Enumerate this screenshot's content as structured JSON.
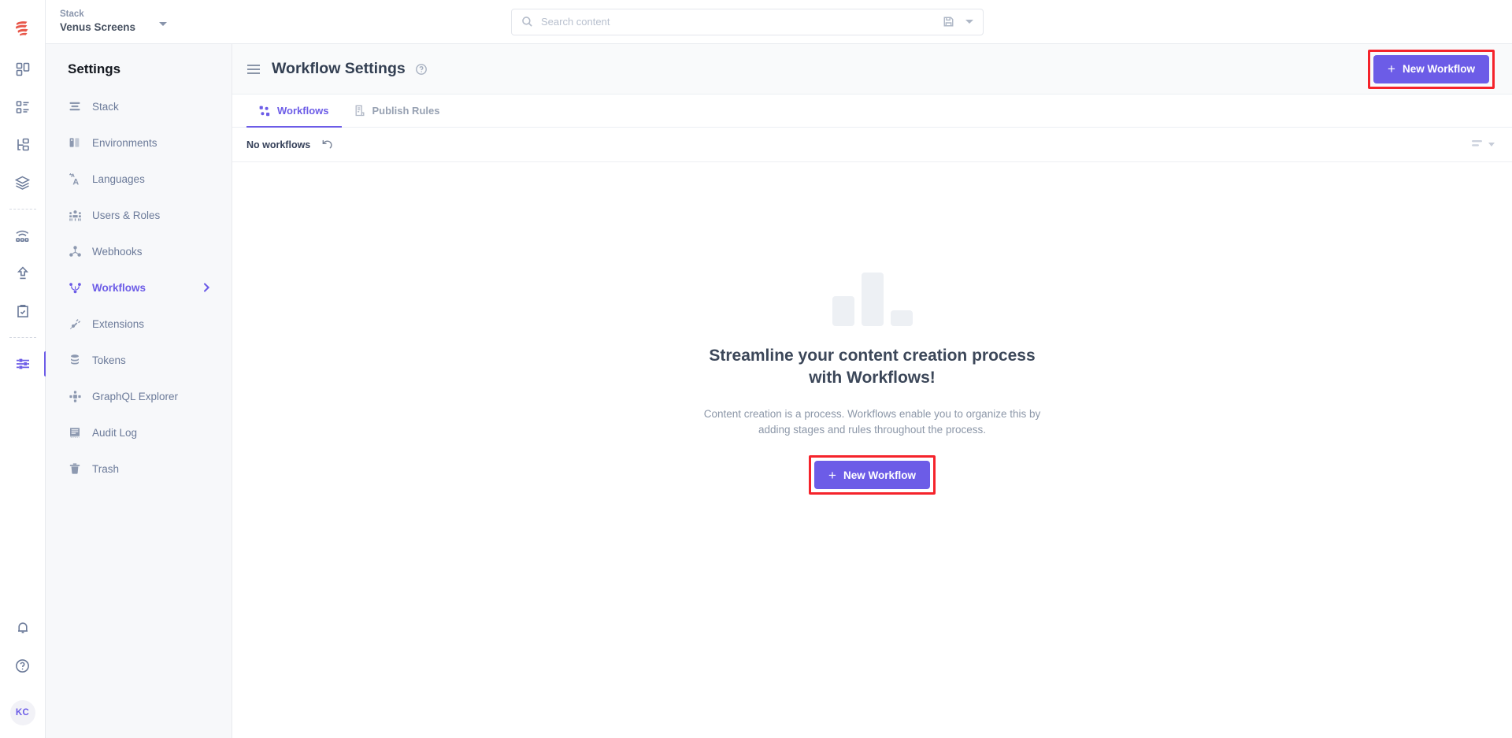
{
  "brand": {
    "accent": "#6c5ce7",
    "annotation": "#f5232b",
    "logo_icon": "contentstack-logo-icon"
  },
  "topbar": {
    "stack_label": "Stack",
    "stack_name": "Venus Screens",
    "stack_caret_icon": "chevron-down-icon",
    "search": {
      "placeholder": "Search content",
      "value": "",
      "search_icon": "search-icon",
      "save_icon": "save-icon",
      "caret_icon": "chevron-down-icon"
    }
  },
  "rail": {
    "items": [
      {
        "name": "dashboard",
        "icon": "dashboard-grid-icon",
        "active": false
      },
      {
        "name": "entries",
        "icon": "list-icon",
        "active": false
      },
      {
        "name": "content-models",
        "icon": "sitemap-icon",
        "active": false
      },
      {
        "name": "assets",
        "icon": "layers-icon",
        "active": false
      },
      {
        "name": "live-preview",
        "icon": "broadcast-icon",
        "active": false
      },
      {
        "name": "releases",
        "icon": "upload-arrow-icon",
        "active": false
      },
      {
        "name": "publish-queue",
        "icon": "clipboard-check-icon",
        "active": false
      },
      {
        "name": "settings",
        "icon": "sliders-icon",
        "active": true
      }
    ],
    "bottom": [
      {
        "name": "notifications",
        "icon": "bell-icon"
      },
      {
        "name": "help",
        "icon": "question-circle-icon"
      }
    ],
    "avatar_initials": "KC"
  },
  "settings_sidebar": {
    "title": "Settings",
    "items": [
      {
        "label": "Stack",
        "icon": "stack-icon",
        "active": false
      },
      {
        "label": "Environments",
        "icon": "environments-icon",
        "active": false
      },
      {
        "label": "Languages",
        "icon": "translate-icon",
        "active": false
      },
      {
        "label": "Users & Roles",
        "icon": "users-icon",
        "active": false
      },
      {
        "label": "Webhooks",
        "icon": "webhooks-icon",
        "active": false
      },
      {
        "label": "Workflows",
        "icon": "workflows-icon",
        "active": true,
        "chevron_icon": "chevron-right-icon"
      },
      {
        "label": "Extensions",
        "icon": "extensions-plug-icon",
        "active": false
      },
      {
        "label": "Tokens",
        "icon": "tokens-database-icon",
        "active": false
      },
      {
        "label": "GraphQL Explorer",
        "icon": "graphql-icon",
        "active": false
      },
      {
        "label": "Audit Log",
        "icon": "audit-log-icon",
        "active": false
      },
      {
        "label": "Trash",
        "icon": "trash-icon",
        "active": false
      }
    ]
  },
  "page": {
    "menu_icon": "hamburger-icon",
    "title": "Workflow Settings",
    "help_icon": "question-circle-icon",
    "new_workflow_label": "New Workflow",
    "new_workflow_plus_icon": "plus-icon",
    "tabs": [
      {
        "label": "Workflows",
        "icon": "workflows-tab-icon",
        "active": true
      },
      {
        "label": "Publish Rules",
        "icon": "publish-rules-icon",
        "active": false
      }
    ],
    "list": {
      "status_label": "No workflows",
      "refresh_icon": "refresh-undo-icon",
      "sort_icon": "sort-lines-icon",
      "sort_caret_icon": "chevron-down-icon"
    },
    "empty_state": {
      "illustration": "bar-chart-placeholder-illustration",
      "bars": [
        38,
        68,
        20
      ],
      "heading": "Streamline your content creation process with Workflows!",
      "body": "Content creation is a process. Workflows enable you to organize this by adding stages and rules throughout the process.",
      "cta_label": "New Workflow",
      "cta_plus_icon": "plus-icon"
    }
  }
}
